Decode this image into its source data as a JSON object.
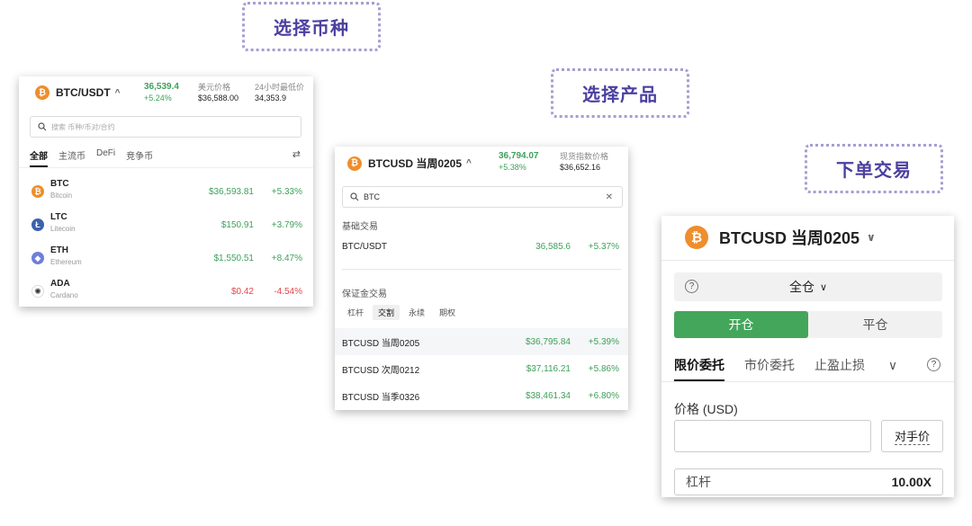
{
  "steps": {
    "select_coin": "选择币种",
    "select_product": "选择产品",
    "place_order": "下单交易"
  },
  "panel1": {
    "pair": "BTC/USDT",
    "last_price": "36,539.4",
    "change": "+5.24%",
    "usd_price_label": "美元价格",
    "usd_price": "$36,588.00",
    "low_label": "24小时最低价",
    "low_value": "34,353.9",
    "search_placeholder": "搜索 币种/币对/合约",
    "tabs": [
      "全部",
      "主流币",
      "DeFi",
      "竞争币"
    ],
    "rows": [
      {
        "symbol": "BTC",
        "name": "Bitcoin",
        "price": "$36,593.81",
        "change": "+5.33%"
      },
      {
        "symbol": "LTC",
        "name": "Litecoin",
        "price": "$150.91",
        "change": "+3.79%"
      },
      {
        "symbol": "ETH",
        "name": "Ethereum",
        "price": "$1,550.51",
        "change": "+8.47%"
      },
      {
        "symbol": "ADA",
        "name": "Cardano",
        "price": "$0.42",
        "change": "-4.54%"
      }
    ]
  },
  "panel2": {
    "contract": "BTCUSD 当周0205",
    "last_price": "36,794.07",
    "change": "+5.38%",
    "index_label": "现货指数价格",
    "index_value": "$36,652.16",
    "search_value": "BTC",
    "section_basic": "基础交易",
    "basic_rows": [
      {
        "symbol": "BTC/USDT",
        "price": "36,585.6",
        "change": "+5.37%"
      }
    ],
    "section_margin": "保证金交易",
    "filters": [
      "杠杆",
      "交割",
      "永续",
      "期权"
    ],
    "margin_rows": [
      {
        "symbol": "BTCUSD 当周0205",
        "price": "$36,795.84",
        "change": "+5.39%"
      },
      {
        "symbol": "BTCUSD 次周0212",
        "price": "$37,116.21",
        "change": "+5.86%"
      },
      {
        "symbol": "BTCUSD 当季0326",
        "price": "$38,461.34",
        "change": "+6.80%"
      }
    ]
  },
  "panel3": {
    "contract": "BTCUSD 当周0205",
    "margin_mode": "全仓",
    "open": "开仓",
    "close": "平仓",
    "order_tabs": [
      "限价委托",
      "市价委托",
      "止盈止损"
    ],
    "price_label": "价格 (USD)",
    "counter_price": "对手价",
    "leverage_label": "杠杆",
    "leverage_value": "10.00X"
  },
  "colors": {
    "up": "#3ea15a",
    "down": "#e0474c",
    "btc": "#ee8e2c",
    "accent": "#44a65a"
  }
}
